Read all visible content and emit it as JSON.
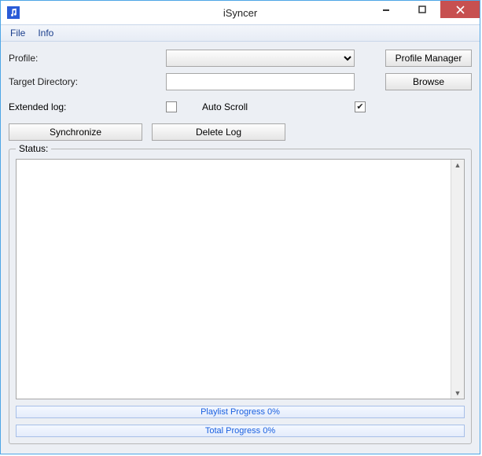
{
  "window": {
    "title": "iSyncer"
  },
  "menu": {
    "file": "File",
    "info": "Info"
  },
  "form": {
    "profile_label": "Profile:",
    "profile_value": "",
    "profile_manager_btn": "Profile Manager",
    "target_dir_label": "Target Directory:",
    "target_dir_value": "",
    "browse_btn": "Browse",
    "extended_log_label": "Extended log:",
    "extended_log_checked": false,
    "auto_scroll_label": "Auto Scroll",
    "auto_scroll_checked": true
  },
  "actions": {
    "synchronize": "Synchronize",
    "delete_log": "Delete Log"
  },
  "status": {
    "legend": "Status:",
    "log_text": "",
    "playlist_progress_label": "Playlist Progress 0%",
    "total_progress_label": "Total Progress 0%"
  }
}
